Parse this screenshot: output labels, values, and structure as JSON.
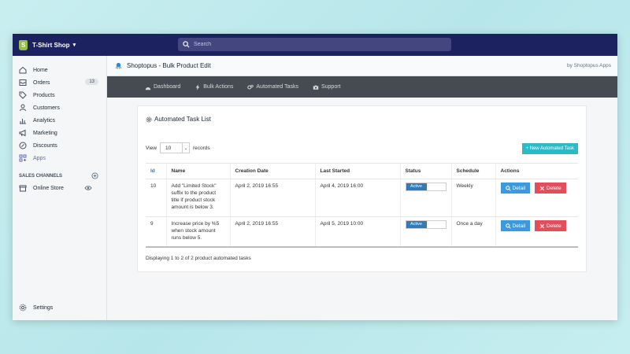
{
  "topbar": {
    "shop_name": "T-Shirt Shop",
    "search_placeholder": "Search"
  },
  "sidebar": {
    "items": [
      {
        "label": "Home",
        "icon": "home-icon"
      },
      {
        "label": "Orders",
        "icon": "orders-icon",
        "badge": "13"
      },
      {
        "label": "Products",
        "icon": "tag-icon"
      },
      {
        "label": "Customers",
        "icon": "person-icon"
      },
      {
        "label": "Analytics",
        "icon": "chart-icon"
      },
      {
        "label": "Marketing",
        "icon": "megaphone-icon"
      },
      {
        "label": "Discounts",
        "icon": "discount-icon"
      },
      {
        "label": "Apps",
        "icon": "apps-icon"
      }
    ],
    "sales_channels_label": "SALES CHANNELS",
    "online_store_label": "Online Store",
    "settings_label": "Settings"
  },
  "app": {
    "title": "Shoptopus - Bulk Product Edit",
    "by": "by Shoptopus Apps",
    "nav": [
      "Dashboard",
      "Bulk Actions",
      "Automated Tasks",
      "Support"
    ]
  },
  "card": {
    "title": "Automated Task List",
    "view_label": "View",
    "view_value": "10",
    "records_label": "records",
    "new_task_label": "+ New Automated Task",
    "footer": "Displaying 1 to 2 of 2 product automated tasks"
  },
  "table": {
    "headers": [
      "Id",
      "Name",
      "Creation Date",
      "Last Started",
      "Status",
      "Schedule",
      "Actions"
    ],
    "rows": [
      {
        "id": "10",
        "name": "Add \"Limited Stock\" suffix to the product title if product stock amount is below 3.",
        "created": "April 2, 2019 16:55",
        "last_started": "April 4, 2019 16:00",
        "status": "Active",
        "schedule": "Weekly",
        "detail": "Detail",
        "delete": "Delete"
      },
      {
        "id": "9",
        "name": "Increase price by %5 when stock amount runs below 5.",
        "created": "April 2, 2019 16:55",
        "last_started": "April 5, 2019 10:00",
        "status": "Active",
        "schedule": "Once a day",
        "detail": "Detail",
        "delete": "Delete"
      }
    ]
  },
  "colors": {
    "topbar": "#1c2260",
    "app_nav": "#464a52",
    "primary": "#337ab7",
    "teal": "#2bbbc6",
    "danger": "#e04f5b"
  }
}
